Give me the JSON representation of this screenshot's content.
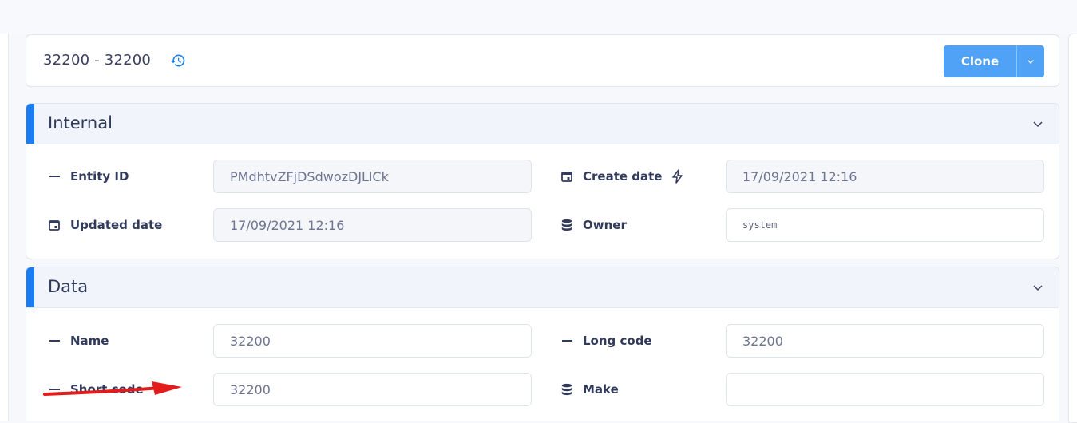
{
  "header": {
    "title": "32200 - 32200",
    "clone_label": "Clone"
  },
  "colors": {
    "accent": "#1a7df1",
    "button": "#4fa2f5",
    "annotation_arrow": "#e21b1b"
  },
  "sections": {
    "internal": {
      "title": "Internal",
      "entity_id": {
        "label": "Entity ID",
        "value": "PMdhtvZFjDSdwozDJLlCk"
      },
      "create_date": {
        "label": "Create date",
        "value": "17/09/2021 12:16"
      },
      "updated_date": {
        "label": "Updated date",
        "value": "17/09/2021 12:16"
      },
      "owner": {
        "label": "Owner",
        "value": "system"
      }
    },
    "data": {
      "title": "Data",
      "name": {
        "label": "Name",
        "value": "32200"
      },
      "long_code": {
        "label": "Long code",
        "value": "32200"
      },
      "short_code": {
        "label": "Short code",
        "value": "32200"
      },
      "make": {
        "label": "Make",
        "value": ""
      }
    }
  }
}
